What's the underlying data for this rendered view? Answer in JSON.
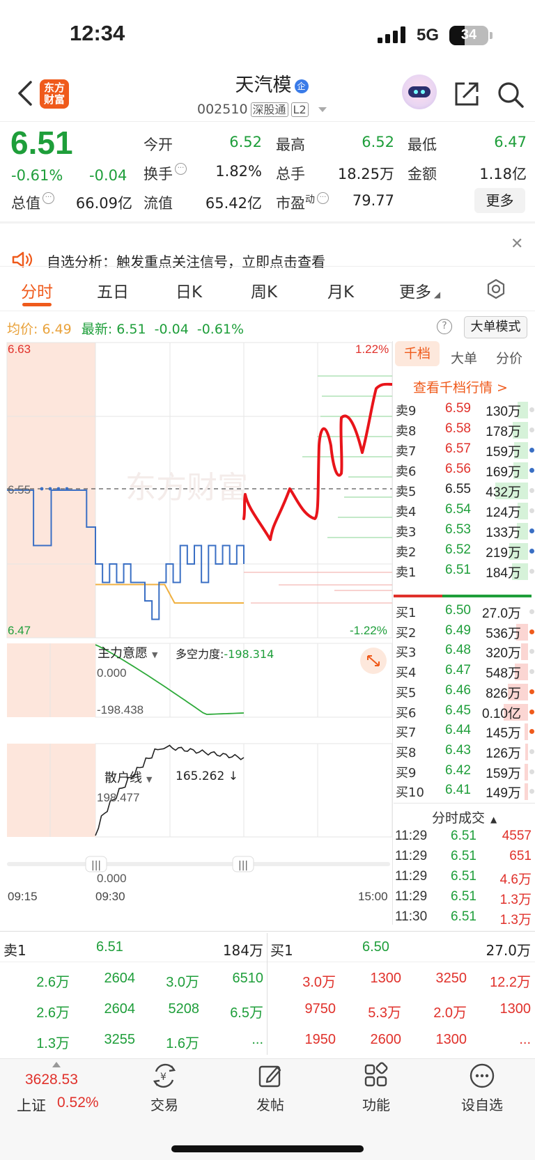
{
  "status": {
    "time": "12:34",
    "network": "5G",
    "battery": "34"
  },
  "header": {
    "title": "天汽模",
    "badge": "企",
    "code": "002510",
    "tag1": "深股通",
    "tag2": "L2",
    "logo": "东方财富"
  },
  "quote": {
    "price": "6.51",
    "pct": "-0.61%",
    "change": "-0.04",
    "open_label": "今开",
    "open": "6.52",
    "high_label": "最高",
    "high": "6.52",
    "low_label": "最低",
    "low": "6.47",
    "turnover_label": "换手",
    "turnover": "1.82%",
    "volume_label": "总手",
    "volume": "18.25万",
    "amount_label": "金额",
    "amount": "1.18亿",
    "mktcap_label": "总值",
    "mktcap": "66.09亿",
    "float_label": "流值",
    "float": "65.42亿",
    "pe_label": "市盈",
    "pe_sup": "动",
    "pe": "79.77",
    "more": "更多"
  },
  "notice": {
    "text": "自选分析：触发重点关注信号，立即点击查看"
  },
  "tabs": [
    "分时",
    "五日",
    "日K",
    "周K",
    "月K",
    "更多"
  ],
  "avgrow": {
    "avg_label": "均价:",
    "avg": "6.49",
    "latest_label": "最新:",
    "latest": "6.51",
    "chg": "-0.04",
    "pct": "-0.61%",
    "mode": "大单模式"
  },
  "chart": {
    "ymax": "6.63",
    "ymid": "6.55",
    "ymin": "6.47",
    "pct_top": "1.22%",
    "pct_bottom": "-1.22%",
    "ind1_label": "主力意愿",
    "ind1_desc_label": "多空力度:",
    "ind1_desc_value": "-198.314",
    "ind1_top": "0.000",
    "ind1_bottom": "-198.438",
    "ind2_label": "散户线",
    "ind2_value": "165.262 ↓",
    "ind2_top": "198.477",
    "ind2_bottom": "0.000",
    "t_start": "09:15",
    "t_open": "09:30",
    "t_end": "15:00",
    "watermark": "东方财富"
  },
  "chart_data": {
    "type": "line",
    "title": "",
    "ylim": [
      6.47,
      6.63
    ],
    "series": [
      {
        "name": "",
        "values": [
          6.55,
          6.55,
          6.55,
          6.52,
          6.52,
          6.55,
          6.55,
          6.55,
          6.55,
          6.53,
          6.51,
          6.5,
          6.51,
          6.5,
          6.51,
          6.5,
          6.5,
          6.49,
          6.48,
          6.5,
          6.51,
          6.5,
          6.52,
          6.51,
          6.52,
          6.5,
          6.52,
          6.51,
          6.52,
          6.51,
          6.52,
          6.51
        ]
      },
      {
        "name": "",
        "values": [
          6.5,
          6.5,
          6.5,
          6.5,
          6.5,
          6.5,
          6.5,
          6.5,
          6.49,
          6.49,
          6.49,
          6.49,
          6.49,
          6.49,
          6.49,
          6.49
        ]
      }
    ]
  },
  "orderbook": {
    "tabs": [
      "千档",
      "大单",
      "分价"
    ],
    "link": "查看千档行情 >",
    "asks": [
      {
        "label": "卖9",
        "price": "6.59",
        "vol": "130万"
      },
      {
        "label": "卖8",
        "price": "6.58",
        "vol": "178万"
      },
      {
        "label": "卖7",
        "price": "6.57",
        "vol": "159万"
      },
      {
        "label": "卖6",
        "price": "6.56",
        "vol": "169万"
      },
      {
        "label": "卖5",
        "price": "6.55",
        "vol": "432万"
      },
      {
        "label": "卖4",
        "price": "6.54",
        "vol": "124万"
      },
      {
        "label": "卖3",
        "price": "6.53",
        "vol": "133万"
      },
      {
        "label": "卖2",
        "price": "6.52",
        "vol": "219万"
      },
      {
        "label": "卖1",
        "price": "6.51",
        "vol": "184万"
      }
    ],
    "bids": [
      {
        "label": "买1",
        "price": "6.50",
        "vol": "27.0万"
      },
      {
        "label": "买2",
        "price": "6.49",
        "vol": "536万"
      },
      {
        "label": "买3",
        "price": "6.48",
        "vol": "320万"
      },
      {
        "label": "买4",
        "price": "6.47",
        "vol": "548万"
      },
      {
        "label": "买5",
        "price": "6.46",
        "vol": "826万"
      },
      {
        "label": "买6",
        "price": "6.45",
        "vol": "0.10亿"
      },
      {
        "label": "买7",
        "price": "6.44",
        "vol": "145万"
      },
      {
        "label": "买8",
        "price": "6.43",
        "vol": "126万"
      },
      {
        "label": "买9",
        "price": "6.42",
        "vol": "159万"
      },
      {
        "label": "买10",
        "price": "6.41",
        "vol": "149万"
      }
    ]
  },
  "trades": {
    "title": "分时成交",
    "rows": [
      {
        "time": "11:29",
        "price": "6.51",
        "vol": "4557"
      },
      {
        "time": "11:29",
        "price": "6.51",
        "vol": "651"
      },
      {
        "time": "11:29",
        "price": "6.51",
        "vol": "4.6万"
      },
      {
        "time": "11:29",
        "price": "6.51",
        "vol": "1.3万"
      },
      {
        "time": "11:30",
        "price": "6.51",
        "vol": "1.3万"
      }
    ]
  },
  "queue": {
    "sell_label": "卖1",
    "sell_price": "6.51",
    "sell_vol": "184万",
    "buy_label": "买1",
    "buy_price": "6.50",
    "buy_vol": "27.0万",
    "sell_rows": [
      [
        "2.6万",
        "2604",
        "3.0万",
        "6510"
      ],
      [
        "2.6万",
        "2604",
        "5208",
        "6.5万"
      ],
      [
        "1.3万",
        "3255",
        "1.6万",
        "..."
      ]
    ],
    "buy_rows": [
      [
        "3.0万",
        "1300",
        "3250",
        "12.2万"
      ],
      [
        "9750",
        "5.3万",
        "2.0万",
        "1300"
      ],
      [
        "1950",
        "2600",
        "1300",
        "..."
      ]
    ]
  },
  "bottomnav": {
    "index_price": "3628.53",
    "index_name": "上证",
    "index_pct": "0.52%",
    "items": [
      "交易",
      "发帖",
      "功能",
      "设自选"
    ]
  }
}
